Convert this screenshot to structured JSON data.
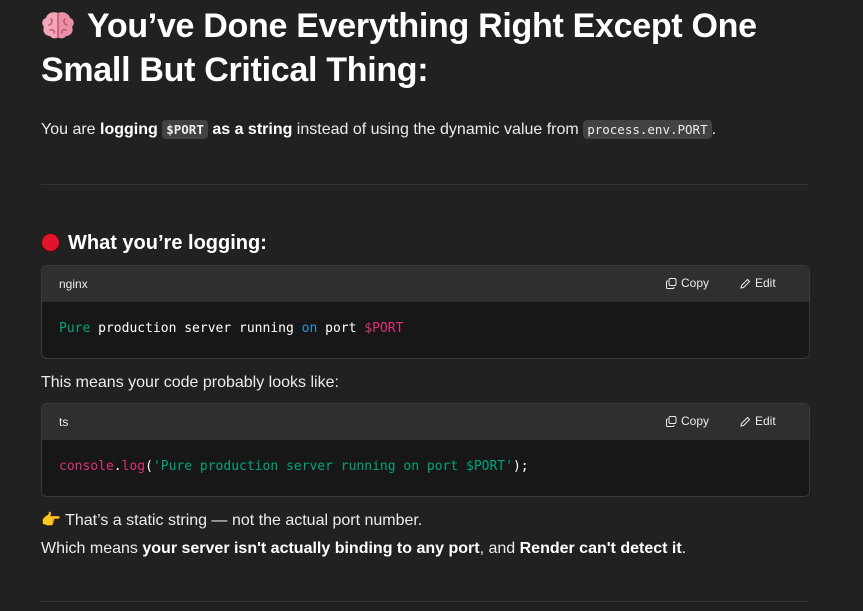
{
  "heading": {
    "line1": "You’ve Done Everything Right Except One",
    "line2": "Small But Critical Thing:"
  },
  "intro": {
    "t1": "You are ",
    "b1": "logging",
    "code1": "$PORT",
    "b2": "as a string",
    "t2": " instead of using the dynamic value from ",
    "code2": "process.env.PORT",
    "t3": "."
  },
  "section": {
    "title": "What you’re logging:"
  },
  "codeblock1": {
    "lang": "nginx",
    "copy": "Copy",
    "edit": "Edit",
    "tokens": [
      "Pure",
      "production server running",
      "on",
      "port",
      "$PORT"
    ]
  },
  "middle_text": "This means your code probably looks like:",
  "codeblock2": {
    "lang": "ts",
    "copy": "Copy",
    "edit": "Edit",
    "tokens": [
      "console",
      ".",
      "log",
      "(",
      "'Pure production server running on port $PORT'",
      ");"
    ]
  },
  "note": {
    "emoji": "👉",
    "text": "That’s a static string — not the actual port number."
  },
  "conclusion": {
    "t1": "Which means ",
    "b1": "your server isn't actually binding to any port",
    "t2": ", and ",
    "b2": "Render can't detect it",
    "t3": "."
  },
  "colors": {
    "background": "#212121",
    "code_bg": "#171717",
    "code_header": "#2f2f2f",
    "token_green": "#00a67d",
    "token_blue": "#2e95d3",
    "token_pink": "#df3079",
    "red_dot": "#e0152b"
  }
}
